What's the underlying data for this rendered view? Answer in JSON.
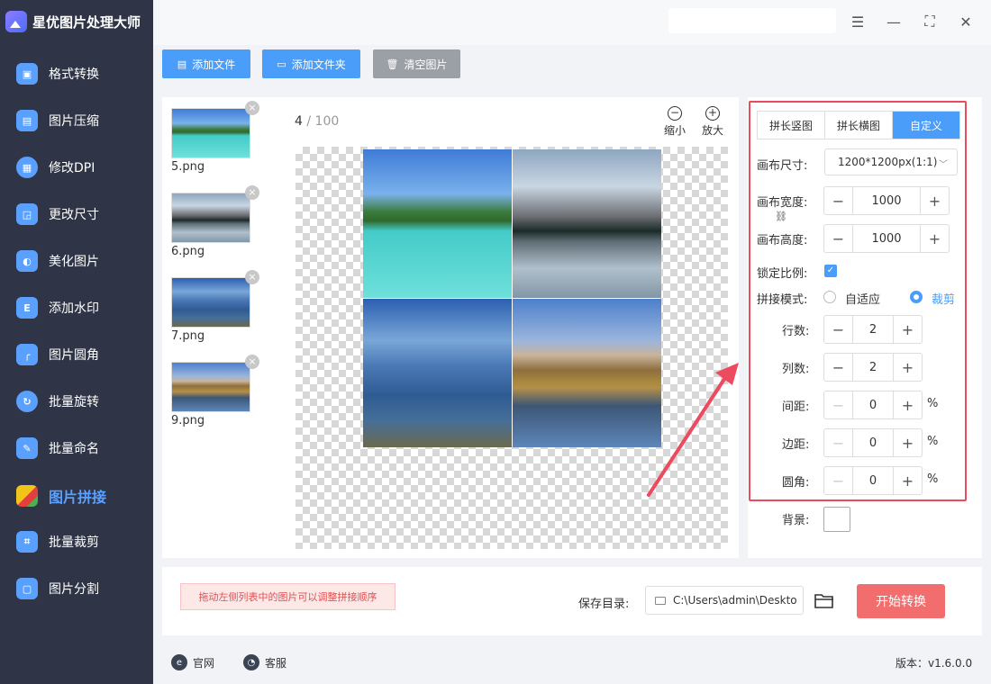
{
  "app": {
    "title": "星优图片处理大师"
  },
  "sidebar": {
    "items": [
      {
        "label": "格式转换",
        "icon": "image-convert-icon",
        "color": "#5aa0ff"
      },
      {
        "label": "图片压缩",
        "icon": "image-compress-icon",
        "color": "#5aa0ff"
      },
      {
        "label": "修改DPI",
        "icon": "dpi-icon",
        "color": "#5aa0ff"
      },
      {
        "label": "更改尺寸",
        "icon": "resize-icon",
        "color": "#5aa0ff"
      },
      {
        "label": "美化图片",
        "icon": "beautify-icon",
        "color": "#5aa0ff"
      },
      {
        "label": "添加水印",
        "icon": "watermark-icon",
        "color": "#5aa0ff"
      },
      {
        "label": "图片圆角",
        "icon": "round-corner-icon",
        "color": "#5aa0ff"
      },
      {
        "label": "批量旋转",
        "icon": "rotate-icon",
        "color": "#5aa0ff"
      },
      {
        "label": "批量命名",
        "icon": "rename-icon",
        "color": "#5aa0ff"
      },
      {
        "label": "图片拼接",
        "icon": "puzzle-icon",
        "color": "#f0c419"
      },
      {
        "label": "批量裁剪",
        "icon": "crop-icon",
        "color": "#5aa0ff"
      },
      {
        "label": "图片分割",
        "icon": "split-icon",
        "color": "#5aa0ff"
      }
    ]
  },
  "toolbar": {
    "add_file": "添加文件",
    "add_folder": "添加文件夹",
    "clear_images": "清空图片"
  },
  "file_list": [
    {
      "name": "5.png"
    },
    {
      "name": "6.png"
    },
    {
      "name": "7.png"
    },
    {
      "name": "9.png"
    }
  ],
  "preview": {
    "current": "4",
    "total": "100",
    "zoom_out": "缩小",
    "zoom_in": "放大"
  },
  "settings": {
    "tabs": [
      "拼长竖图",
      "拼长横图",
      "自定义"
    ],
    "active_tab": "自定义",
    "canvas_size_label": "画布尺寸:",
    "canvas_size_value": "1200*1200px(1:1)",
    "canvas_width_label": "画布宽度:",
    "canvas_width": "1000",
    "canvas_height_label": "画布高度:",
    "canvas_height": "1000",
    "lock_ratio_label": "锁定比例:",
    "lock_ratio": true,
    "mode_label": "拼接模式:",
    "mode_options": [
      "自适应",
      "裁剪"
    ],
    "mode_selected": "裁剪",
    "rows_label": "行数:",
    "rows": "2",
    "cols_label": "列数:",
    "cols": "2",
    "spacing_label": "间距:",
    "spacing": "0",
    "margin_label": "边距:",
    "margin": "0",
    "radius_label": "圆角:",
    "radius": "0",
    "percent": "%",
    "background_label": "背景:",
    "background_color": "#ffffff"
  },
  "bottom": {
    "hint": "拖动左侧列表中的图片可以调整拼接顺序",
    "save_label": "保存目录:",
    "save_path": "C:\\Users\\admin\\Deskto",
    "start_button": "开始转换"
  },
  "footer": {
    "website": "官网",
    "support": "客服",
    "version": "版本：v1.6.0.0"
  },
  "colors": {
    "accent": "#4a9df8",
    "danger": "#f26d6d",
    "highlight_frame": "#ec4a5f",
    "sidebar_bg": "#2f3546"
  }
}
